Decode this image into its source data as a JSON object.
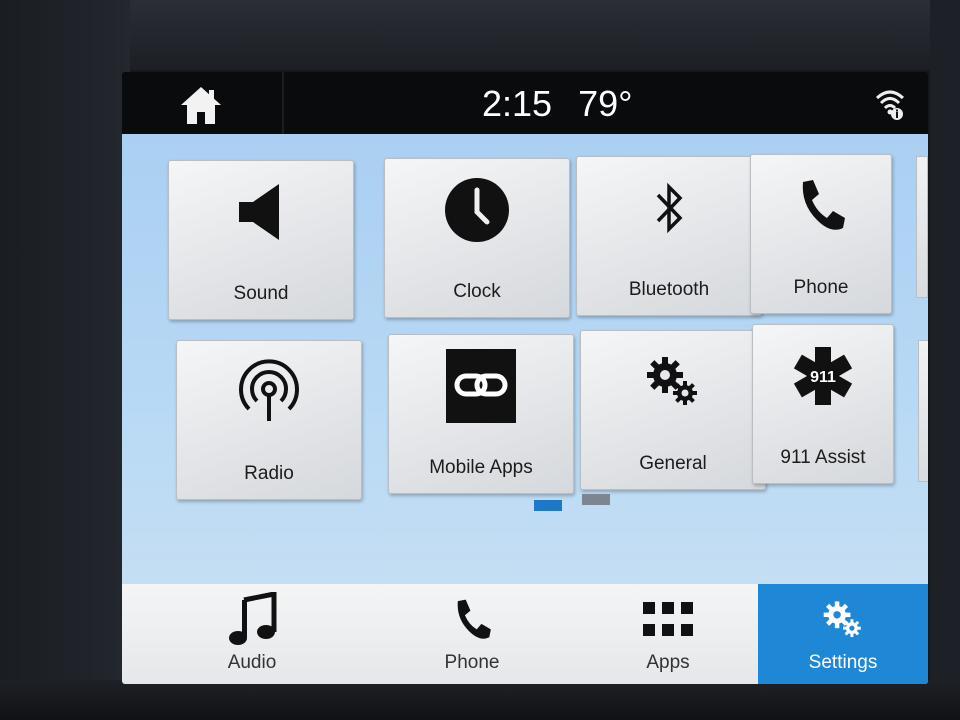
{
  "status": {
    "time": "2:15",
    "temperature": "79°"
  },
  "icons": {
    "home": "home-icon",
    "wifi": "wifi-info-icon",
    "sound": "speaker-icon",
    "clock": "clock-icon",
    "bluetooth": "bluetooth-icon",
    "phone": "phone-icon",
    "radio": "radio-broadcast-icon",
    "mobile_apps": "link-icon",
    "general": "gears-icon",
    "assist": "911-star-of-life-icon",
    "audio": "music-note-icon",
    "apps": "grid-icon",
    "settings": "gears-icon"
  },
  "tiles": [
    {
      "label": "Sound"
    },
    {
      "label": "Clock"
    },
    {
      "label": "Bluetooth"
    },
    {
      "label": "Phone"
    },
    {
      "label": "Radio"
    },
    {
      "label": "Mobile Apps"
    },
    {
      "label": "General"
    },
    {
      "label": "911 Assist",
      "badge": "911"
    }
  ],
  "pagination": {
    "current_page": 1,
    "total_pages": 2
  },
  "nav": [
    {
      "label": "Audio",
      "active": false
    },
    {
      "label": "Phone",
      "active": false
    },
    {
      "label": "Apps",
      "active": false
    },
    {
      "label": "Settings",
      "active": true
    }
  ],
  "colors": {
    "accent": "#1e88d6",
    "content_bg": "#aacff2",
    "page_dot_active": "#1e78c8",
    "page_dot_inactive": "#7d8590"
  }
}
